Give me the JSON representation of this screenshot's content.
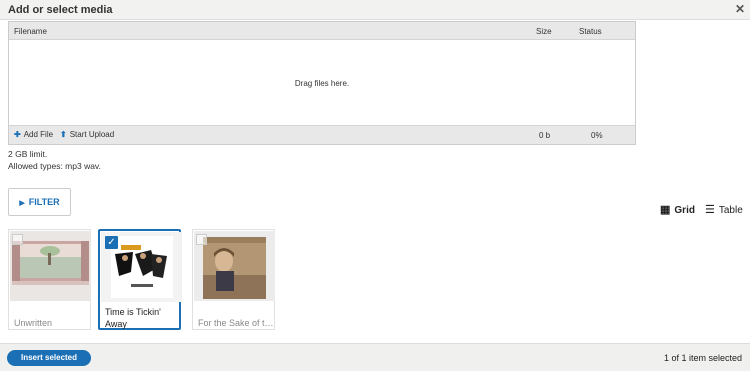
{
  "dialog": {
    "title": "Add or select media",
    "close_icon": "close-icon"
  },
  "uploader": {
    "columns": {
      "filename": "Filename",
      "size": "Size",
      "status": "Status"
    },
    "drop_text": "Drag files here.",
    "add_file_label": "Add File",
    "start_upload_label": "Start Upload",
    "total_size": "0 b",
    "total_status": "0%"
  },
  "limits": {
    "size_limit": "2 GB limit.",
    "allowed_types": "Allowed types: mp3 wav."
  },
  "filter": {
    "label": "FILTER"
  },
  "view": {
    "grid_label": "Grid",
    "table_label": "Table"
  },
  "media": [
    {
      "title": "Unwritten",
      "selected": false
    },
    {
      "title": "Time is Tickin' Away",
      "selected": true
    },
    {
      "title": "For the Sake of the Call",
      "selected": false
    }
  ],
  "footer": {
    "insert_label": "Insert selected",
    "selected_count": "1 of 1 item selected"
  },
  "colors": {
    "accent": "#1a6fb5",
    "footer_bg": "#f0f0ee",
    "header_bg": "#e8e8e8"
  }
}
